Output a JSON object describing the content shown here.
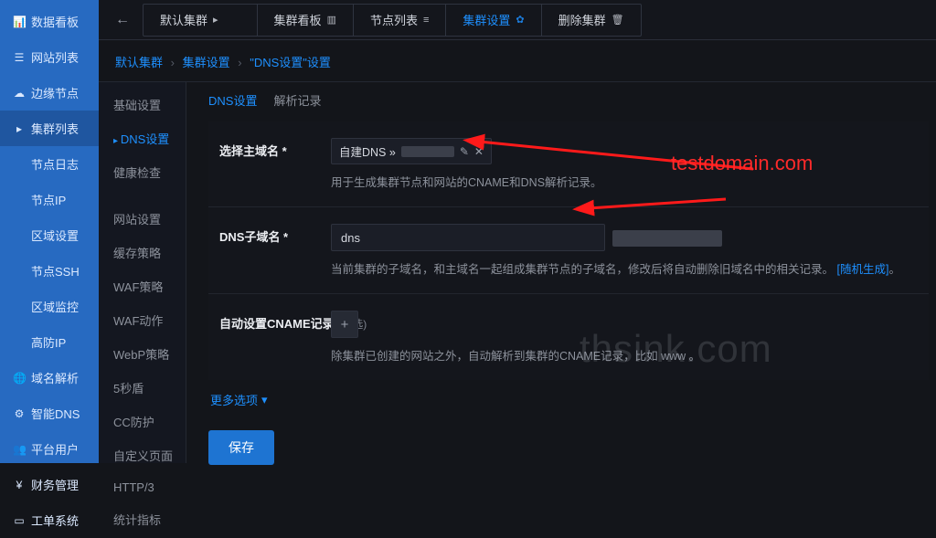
{
  "main_nav": [
    {
      "icon": "📊",
      "label": "数据看板"
    },
    {
      "icon": "☰",
      "label": "网站列表"
    },
    {
      "icon": "☁",
      "label": "边缘节点"
    },
    {
      "icon": "▸",
      "label": "集群列表",
      "selected": true
    },
    {
      "icon": "",
      "label": "节点日志"
    },
    {
      "icon": "",
      "label": "节点IP"
    },
    {
      "icon": "",
      "label": "区域设置"
    },
    {
      "icon": "",
      "label": "节点SSH"
    },
    {
      "icon": "",
      "label": "区域监控"
    },
    {
      "icon": "",
      "label": "高防IP"
    },
    {
      "icon": "🌐",
      "label": "域名解析"
    },
    {
      "icon": "⚙",
      "label": "智能DNS"
    },
    {
      "icon": "👥",
      "label": "平台用户"
    },
    {
      "icon": "¥",
      "label": "财务管理"
    },
    {
      "icon": "▭",
      "label": "工单系统"
    }
  ],
  "topbar": {
    "back": "←",
    "default_cluster": "默认集群",
    "default_cluster_caret": "▸",
    "tabs": [
      {
        "label": "集群看板",
        "icon": "▥"
      },
      {
        "label": "节点列表",
        "icon": "≡"
      },
      {
        "label": "集群设置",
        "icon": "✿",
        "active": true
      },
      {
        "label": "删除集群",
        "icon": "🗑"
      }
    ]
  },
  "breadcrumb": {
    "a": "默认集群",
    "b": "集群设置",
    "c": "\"DNS设置\"设置"
  },
  "subnav": {
    "group1": [
      "基础设置",
      "DNS设置",
      "健康检查"
    ],
    "selected": "DNS设置",
    "group2": [
      "网站设置",
      "缓存策略",
      "WAF策略",
      "WAF动作",
      "WebP策略",
      "5秒盾",
      "CC防护",
      "自定义页面",
      "HTTP/3",
      "统计指标"
    ]
  },
  "inner_tabs": {
    "a": "DNS设置",
    "b": "解析记录",
    "active": "a"
  },
  "form": {
    "row1": {
      "label": "选择主域名 *",
      "chip_prefix": "自建DNS »",
      "help": "用于生成集群节点和网站的CNAME和DNS解析记录。"
    },
    "row2": {
      "label": "DNS子域名 *",
      "value": "dns",
      "help_a": "当前集群的子域名，和主域名一起组成集群节点的子域名，修改后将自动删除旧域名中的相关记录。",
      "help_link": "[随机生成]",
      "help_b": "。"
    },
    "row3": {
      "label_a": "自动设置CNAME记录",
      "label_opt": "(可选)",
      "help": "除集群已创建的网站之外，自动解析到集群的CNAME记录，比如 www 。",
      "plus": "+"
    },
    "more": "更多选项",
    "save": "保存"
  },
  "annotation": {
    "text": "testdomain.com"
  },
  "watermark": "thsink.com"
}
